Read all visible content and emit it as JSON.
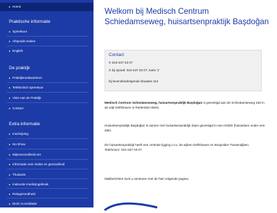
{
  "sidebar": {
    "home_label": "Home",
    "sections": [
      {
        "title": "Praktische informatie",
        "items": [
          "Spreekuur",
          "Afspraak maken",
          "English"
        ]
      },
      {
        "title": "De praktijk",
        "items": [
          "Praktijkmedewerkers",
          "Telefonisch spreekuur",
          "Visie van de Praktijk",
          "Contact"
        ]
      },
      {
        "title": "Extra informatie",
        "items": [
          "Inschrijving",
          "No Show",
          "MijnGezondheid.net",
          "Informatie over ziekte en gezondheid",
          "Thuisarts",
          "Instructie medicijngebruik",
          "Reisgezondheid",
          "NHG Accreditatie"
        ]
      }
    ]
  },
  "main": {
    "title": "Welkom bij Medisch Centrum Schiedamseweg, huisartsenpraktijk Başdoğan",
    "contact": {
      "title": "Contact",
      "phone": "010-437 03 07",
      "urgent": "bij spoed: 010-437 03 07, toets '1'",
      "life_threatening": "bij levensbedreigende situaties 112"
    },
    "para1_bold": "Medisch Centrum Schiedamseweg, huisartsenpraktijk Başdoğan",
    "para1_rest": " is gevestigd aan de Schiedamseweg 160 in de wijk Delfshaven in Rotterdam-West.",
    "para2": "Huisartsenpraktijk Başdoğan is samen met huisartsenpraktijk Stam gevestigd in een HOED (huisartsen onder een dak).",
    "para3_line1": "De huisartsenpraktijk heeft een centrale ligging t.o.v. de wijken Delfshaven en Bospolder-Tussendijken.",
    "para3_line2": "Telefoonnr: 010-437 03 07",
    "para4": "Mailberichten kunt u versturen met de hier volgende pagina."
  },
  "colors": {
    "sidebar": "#1c3ba6",
    "sidebar_active": "#0d2575",
    "accent": "#1c3ba6"
  },
  "icons": {
    "nav_arrow": "chevron-right-icon",
    "phone": "phone-icon",
    "urgent": "phone-icon"
  }
}
